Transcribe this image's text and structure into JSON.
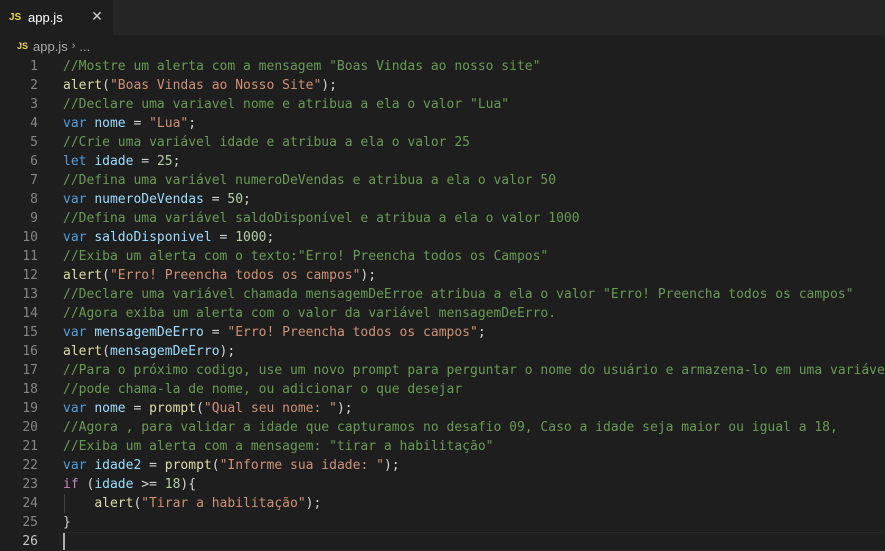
{
  "tab": {
    "badge": "JS",
    "label": "app.js",
    "close": "✕"
  },
  "breadcrumb": {
    "badge": "JS",
    "file": "app.js",
    "sep": "›",
    "more": "..."
  },
  "colors": {
    "comment": "#6a9955",
    "function": "#dcdcaa",
    "string": "#ce9178",
    "keyword": "#569cd6",
    "control": "#c586c0",
    "variable": "#9cdcfe",
    "number": "#b5cea8"
  },
  "lines": [
    {
      "n": "1",
      "tokens": [
        {
          "t": "//Mostre um alerta com a mensagem \"Boas Vindas ao nosso site\"",
          "c": "comment"
        }
      ]
    },
    {
      "n": "2",
      "tokens": [
        {
          "t": "alert",
          "c": "fn"
        },
        {
          "t": "(",
          "c": "op"
        },
        {
          "t": "\"Boas Vindas ao Nosso Site\"",
          "c": "str"
        },
        {
          "t": ");",
          "c": "op"
        }
      ]
    },
    {
      "n": "3",
      "tokens": [
        {
          "t": "//Declare uma variavel nome e atribua a ela o valor \"Lua\"",
          "c": "comment"
        }
      ]
    },
    {
      "n": "4",
      "tokens": [
        {
          "t": "var",
          "c": "kw"
        },
        {
          "t": " ",
          "c": "op"
        },
        {
          "t": "nome",
          "c": "var"
        },
        {
          "t": " = ",
          "c": "op"
        },
        {
          "t": "\"Lua\"",
          "c": "str"
        },
        {
          "t": ";",
          "c": "op"
        }
      ]
    },
    {
      "n": "5",
      "tokens": [
        {
          "t": "//Crie uma variável idade e atribua a ela o valor 25",
          "c": "comment"
        }
      ]
    },
    {
      "n": "6",
      "tokens": [
        {
          "t": "let",
          "c": "kw"
        },
        {
          "t": " ",
          "c": "op"
        },
        {
          "t": "idade",
          "c": "var"
        },
        {
          "t": " = ",
          "c": "op"
        },
        {
          "t": "25",
          "c": "num"
        },
        {
          "t": ";",
          "c": "op"
        }
      ]
    },
    {
      "n": "7",
      "tokens": [
        {
          "t": "//Defina uma variável numeroDeVendas e atribua a ela o valor 50",
          "c": "comment"
        }
      ]
    },
    {
      "n": "8",
      "tokens": [
        {
          "t": "var",
          "c": "kw"
        },
        {
          "t": " ",
          "c": "op"
        },
        {
          "t": "numeroDeVendas",
          "c": "var"
        },
        {
          "t": " = ",
          "c": "op"
        },
        {
          "t": "50",
          "c": "num"
        },
        {
          "t": ";",
          "c": "op"
        }
      ]
    },
    {
      "n": "9",
      "tokens": [
        {
          "t": "//Defina uma variável saldoDisponível e atribua a ela o valor 1000",
          "c": "comment"
        }
      ]
    },
    {
      "n": "10",
      "tokens": [
        {
          "t": "var",
          "c": "kw"
        },
        {
          "t": " ",
          "c": "op"
        },
        {
          "t": "saldoDisponivel",
          "c": "var"
        },
        {
          "t": " = ",
          "c": "op"
        },
        {
          "t": "1000",
          "c": "num"
        },
        {
          "t": ";",
          "c": "op"
        }
      ]
    },
    {
      "n": "11",
      "tokens": [
        {
          "t": "//Exiba um alerta com o texto:\"Erro! Preencha todos os Campos\"",
          "c": "comment"
        }
      ]
    },
    {
      "n": "12",
      "tokens": [
        {
          "t": "alert",
          "c": "fn"
        },
        {
          "t": "(",
          "c": "op"
        },
        {
          "t": "\"Erro! Preencha todos os campos\"",
          "c": "str"
        },
        {
          "t": ");",
          "c": "op"
        }
      ]
    },
    {
      "n": "13",
      "tokens": [
        {
          "t": "//Declare uma variável chamada mensagemDeErroe atribua a ela o valor \"Erro! Preencha todos os campos\"",
          "c": "comment"
        }
      ]
    },
    {
      "n": "14",
      "tokens": [
        {
          "t": "//Agora exiba um alerta com o valor da variável mensagemDeErro.",
          "c": "comment"
        }
      ]
    },
    {
      "n": "15",
      "tokens": [
        {
          "t": "var",
          "c": "kw"
        },
        {
          "t": " ",
          "c": "op"
        },
        {
          "t": "mensagemDeErro",
          "c": "var"
        },
        {
          "t": " = ",
          "c": "op"
        },
        {
          "t": "\"Erro! Preencha todos os campos\"",
          "c": "str"
        },
        {
          "t": ";",
          "c": "op"
        }
      ]
    },
    {
      "n": "16",
      "tokens": [
        {
          "t": "alert",
          "c": "fn"
        },
        {
          "t": "(",
          "c": "op"
        },
        {
          "t": "mensagemDeErro",
          "c": "var"
        },
        {
          "t": ");",
          "c": "op"
        }
      ]
    },
    {
      "n": "17",
      "tokens": [
        {
          "t": "//Para o próximo codigo, use um novo prompt para perguntar o nome do usuário e armazena-lo em uma variável",
          "c": "comment"
        }
      ]
    },
    {
      "n": "18",
      "tokens": [
        {
          "t": "//pode chama-la de nome, ou adicionar o que desejar",
          "c": "comment"
        }
      ]
    },
    {
      "n": "19",
      "tokens": [
        {
          "t": "var",
          "c": "kw"
        },
        {
          "t": " ",
          "c": "op"
        },
        {
          "t": "nome",
          "c": "var"
        },
        {
          "t": " = ",
          "c": "op"
        },
        {
          "t": "prompt",
          "c": "fn"
        },
        {
          "t": "(",
          "c": "op"
        },
        {
          "t": "\"Qual seu nome: \"",
          "c": "str"
        },
        {
          "t": ");",
          "c": "op"
        }
      ]
    },
    {
      "n": "20",
      "tokens": [
        {
          "t": "//Agora , para validar a idade que capturamos no desafio 09, Caso a idade seja maior ou igual a 18,",
          "c": "comment"
        }
      ]
    },
    {
      "n": "21",
      "tokens": [
        {
          "t": "//Exiba um alerta com a mensagem: \"tirar a habilitação\"",
          "c": "comment"
        }
      ]
    },
    {
      "n": "22",
      "tokens": [
        {
          "t": "var",
          "c": "kw"
        },
        {
          "t": " ",
          "c": "op"
        },
        {
          "t": "idade2",
          "c": "var"
        },
        {
          "t": " = ",
          "c": "op"
        },
        {
          "t": "prompt",
          "c": "fn"
        },
        {
          "t": "(",
          "c": "op"
        },
        {
          "t": "\"Informe sua idade: \"",
          "c": "str"
        },
        {
          "t": ");",
          "c": "op"
        }
      ]
    },
    {
      "n": "23",
      "tokens": [
        {
          "t": "if",
          "c": "ctrl"
        },
        {
          "t": " (",
          "c": "op"
        },
        {
          "t": "idade",
          "c": "var"
        },
        {
          "t": " >= ",
          "c": "op"
        },
        {
          "t": "18",
          "c": "num"
        },
        {
          "t": "){",
          "c": "op"
        }
      ]
    },
    {
      "n": "24",
      "tokens": [
        {
          "t": "    ",
          "c": "op"
        },
        {
          "t": "alert",
          "c": "fn"
        },
        {
          "t": "(",
          "c": "op"
        },
        {
          "t": "\"Tirar a habilitação\"",
          "c": "str"
        },
        {
          "t": ");",
          "c": "op"
        }
      ]
    },
    {
      "n": "25",
      "tokens": [
        {
          "t": "}",
          "c": "op"
        }
      ]
    },
    {
      "n": "26",
      "tokens": []
    }
  ]
}
